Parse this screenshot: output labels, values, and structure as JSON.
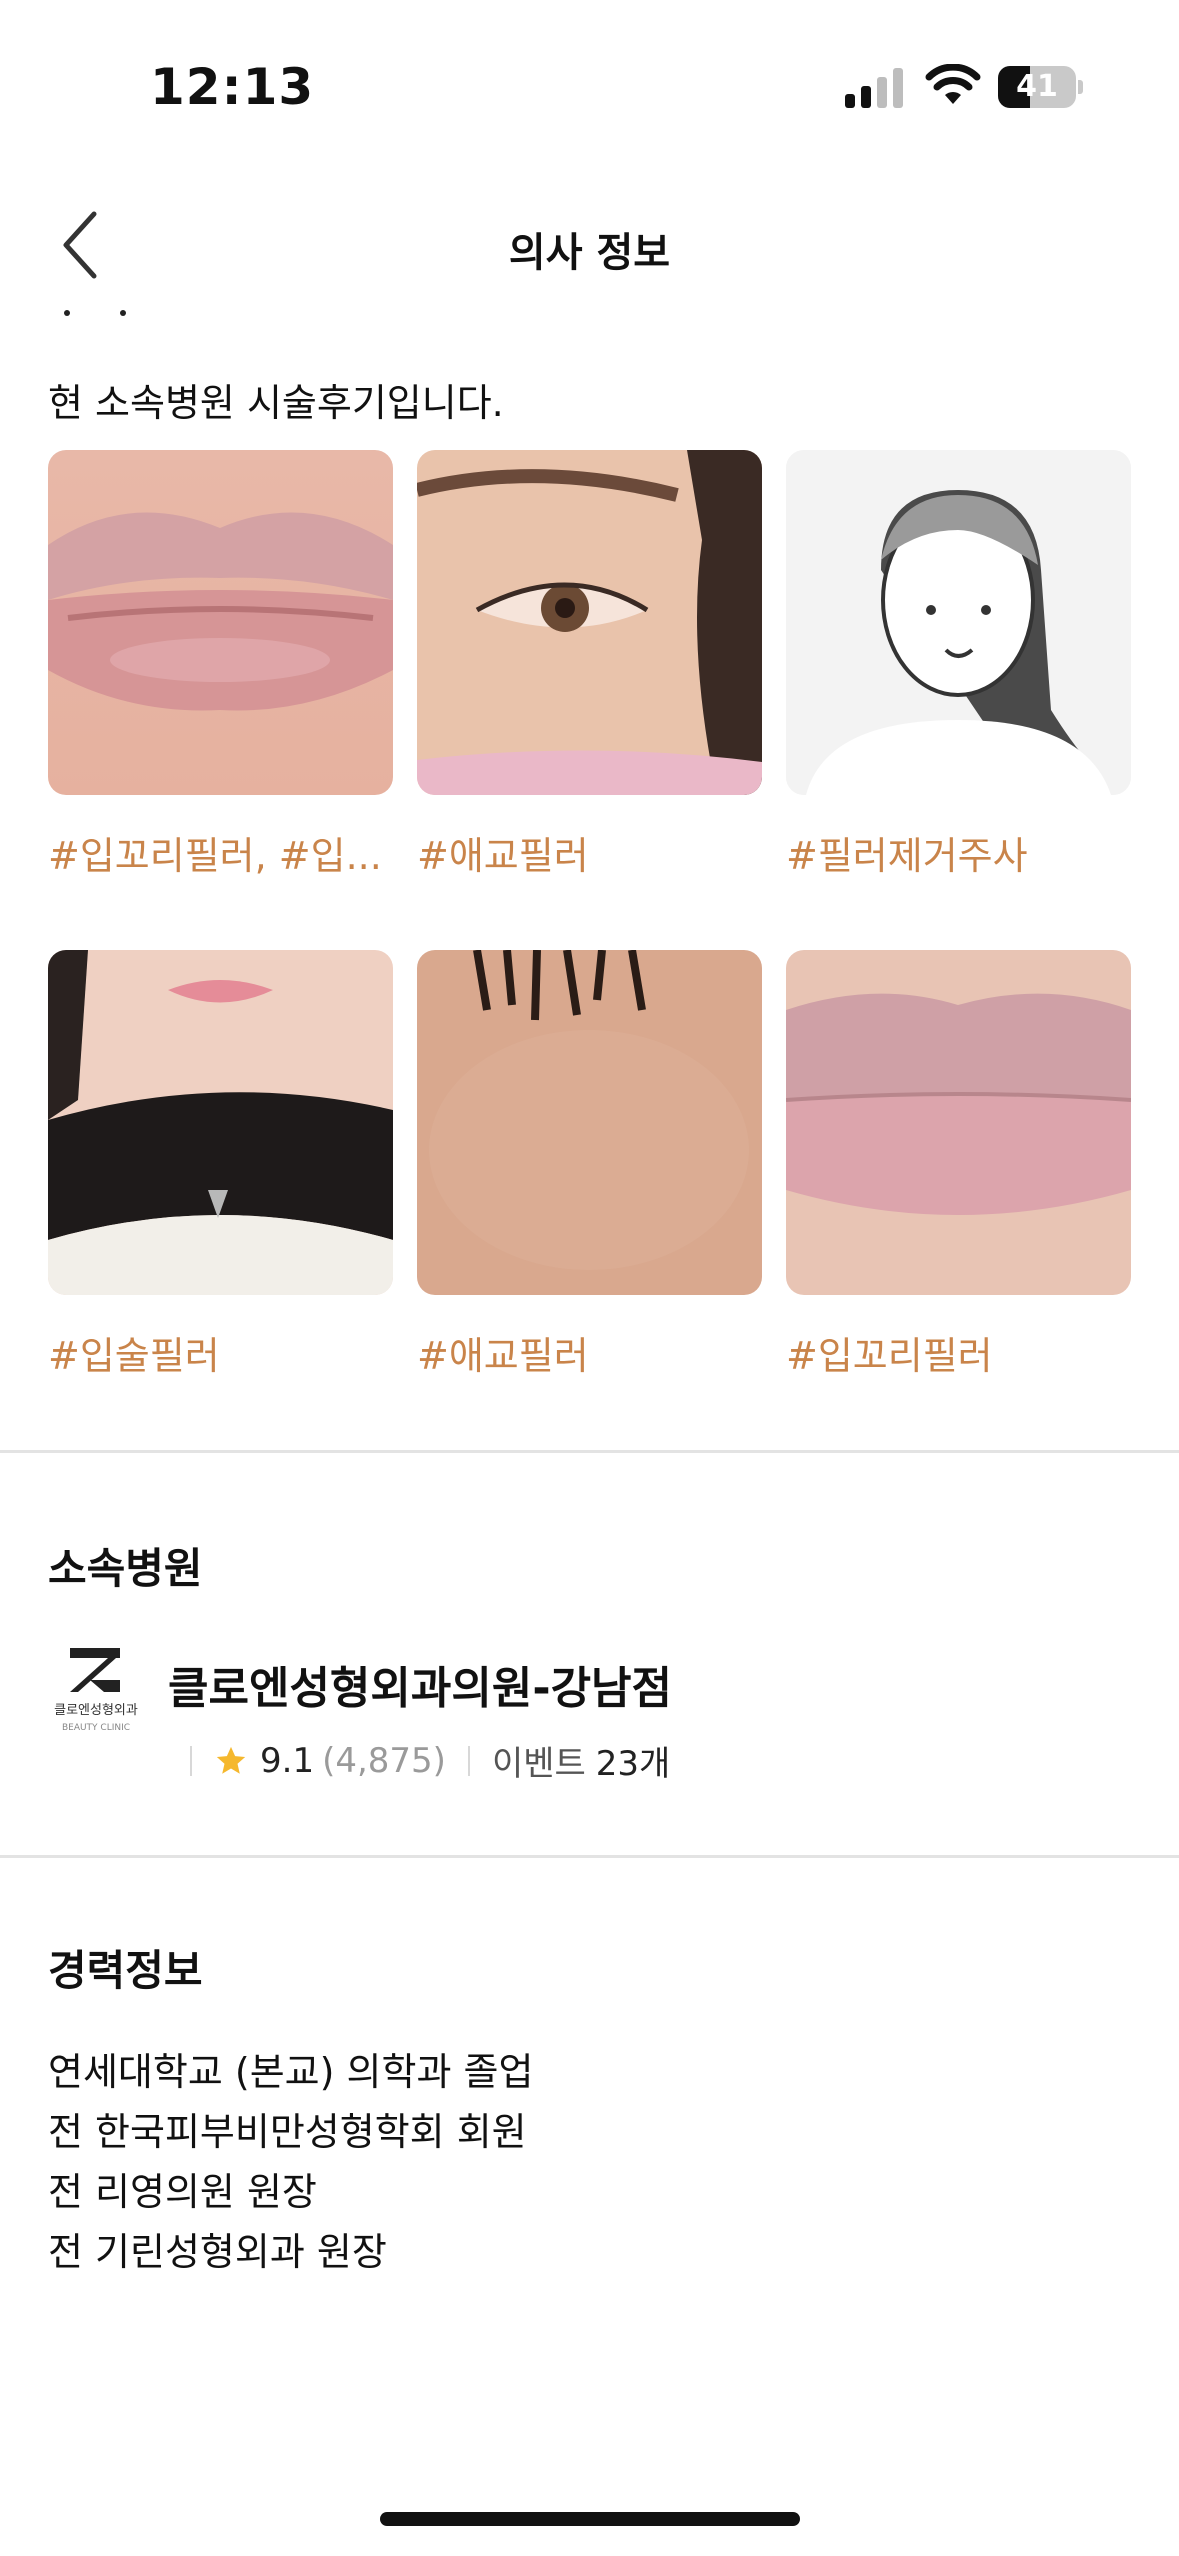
{
  "status_bar": {
    "time": "12:13",
    "battery": "41",
    "battery_level": 0.41
  },
  "header": {
    "title": "의사 정보",
    "back_icon": "chevron-left-icon"
  },
  "intro_text": "현 소속병원 시술후기입니다.",
  "reviews": [
    {
      "tag": "#입꼬리필러, #입...",
      "image": "lips-photo"
    },
    {
      "tag": "#애교필러",
      "image": "under-eye-photo"
    },
    {
      "tag": "#필러제거주사",
      "image": "placeholder-avatar"
    },
    {
      "tag": "#입술필러",
      "image": "face-scarf-photo"
    },
    {
      "tag": "#애교필러",
      "image": "skin-closeup-photo"
    },
    {
      "tag": "#입꼬리필러",
      "image": "lips-closeup-photo"
    }
  ],
  "hospital_section": {
    "title": "소속병원",
    "name": "클로엔성형외과의원-강남점",
    "logo_text": "클로엔성형외과",
    "logo_subtext": "BEAUTY CLINIC",
    "rating": "9.1",
    "review_count": "(4,875)",
    "event_label": "이벤트",
    "event_count": "23개"
  },
  "career_section": {
    "title": "경력정보",
    "items": [
      "연세대학교 (본교) 의학과 졸업",
      "전 한국피부비만성형학회 회원",
      "전 리영의원 원장",
      "전 기린성형외과 원장"
    ]
  },
  "colors": {
    "tag": "#c9844a",
    "star": "#f5b82e",
    "divider": "#e3e3e3"
  }
}
